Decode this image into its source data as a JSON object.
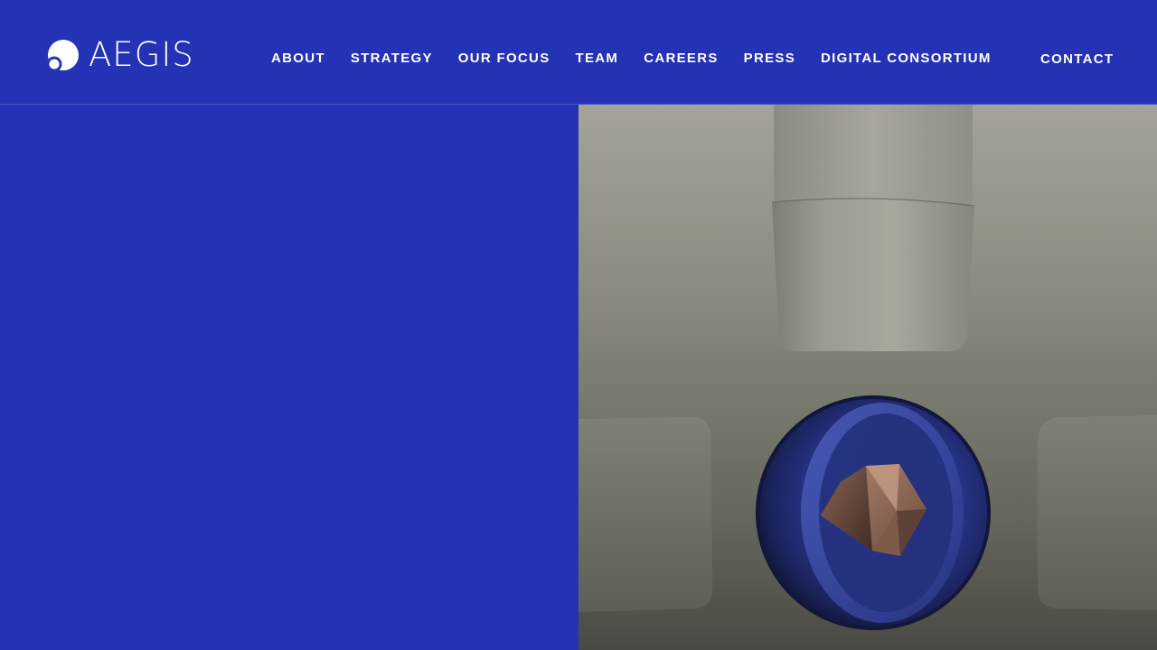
{
  "brand": {
    "name": "AEGIS"
  },
  "nav": {
    "items": [
      {
        "label": "ABOUT"
      },
      {
        "label": "STRATEGY"
      },
      {
        "label": "OUR FOCUS"
      },
      {
        "label": "TEAM"
      },
      {
        "label": "CAREERS"
      },
      {
        "label": "PRESS"
      },
      {
        "label": "DIGITAL CONSORTIUM"
      }
    ],
    "contact_label": "CONTACT"
  },
  "colors": {
    "brand_blue": "#2432b6",
    "text": "#ffffff"
  },
  "hero": {
    "image": "3d-render-robot-arms-holding-blue-sphere-with-copper-crystal"
  }
}
